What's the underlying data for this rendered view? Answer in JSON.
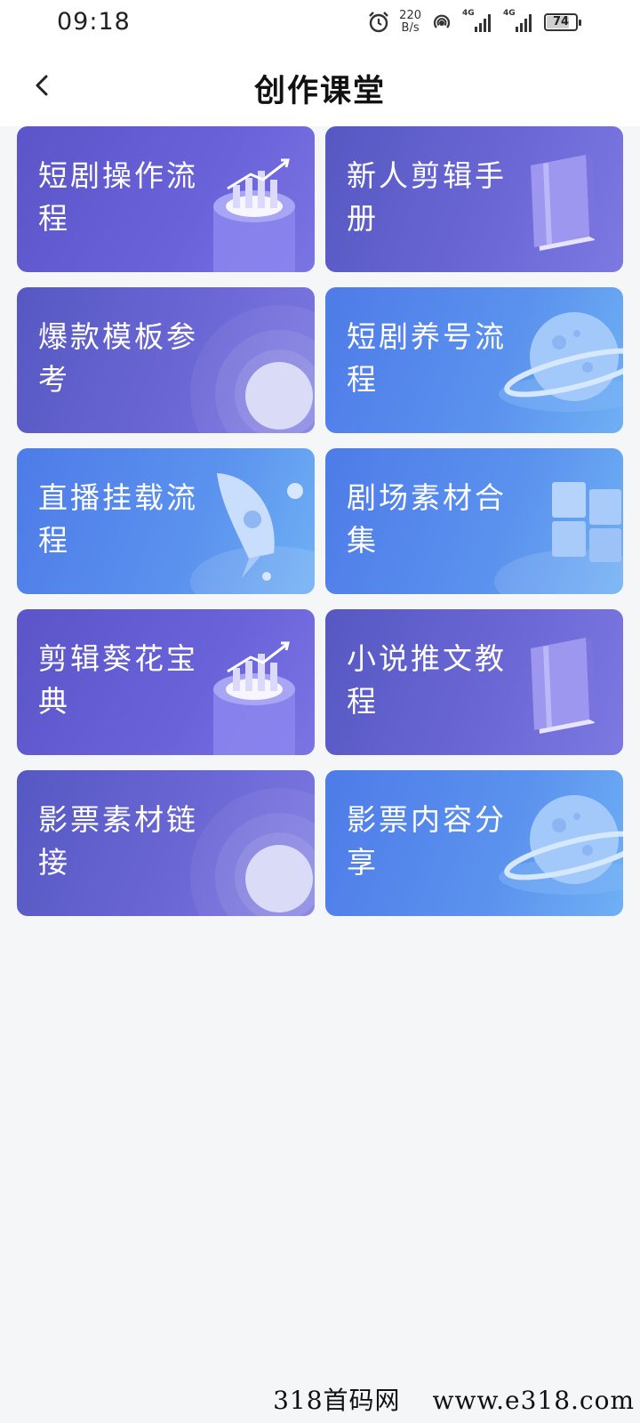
{
  "status_bar": {
    "time": "09:18",
    "net_speed_value": "220",
    "net_speed_unit": "B/s",
    "sim1_label": "4G",
    "sim2_label": "4G",
    "battery_level": "74",
    "battery_fraction": 0.74
  },
  "header": {
    "title": "创作课堂"
  },
  "cards": [
    {
      "label": "短剧操作流程",
      "art": "chart-cylinder-icon",
      "bg": "violet"
    },
    {
      "label": "新人剪辑手册",
      "art": "book-icon",
      "bg": "indigo"
    },
    {
      "label": "爆款模板参考",
      "art": "circle-ripple-icon",
      "bg": "indigo"
    },
    {
      "label": "短剧养号流程",
      "art": "planet-icon",
      "bg": "blue"
    },
    {
      "label": "直播挂载流程",
      "art": "rocket-icon",
      "bg": "blue"
    },
    {
      "label": "剧场素材合集",
      "art": "cubes-icon",
      "bg": "blue"
    },
    {
      "label": "剪辑葵花宝典",
      "art": "chart-cylinder-icon",
      "bg": "violet"
    },
    {
      "label": "小说推文教程",
      "art": "book-icon",
      "bg": "indigo"
    },
    {
      "label": "影票素材链接",
      "art": "circle-ripple-icon",
      "bg": "indigo"
    },
    {
      "label": "影票内容分享",
      "art": "planet-icon",
      "bg": "blue"
    }
  ],
  "watermark": {
    "left_text": "318首码网",
    "right_text": "www.e318.com"
  }
}
